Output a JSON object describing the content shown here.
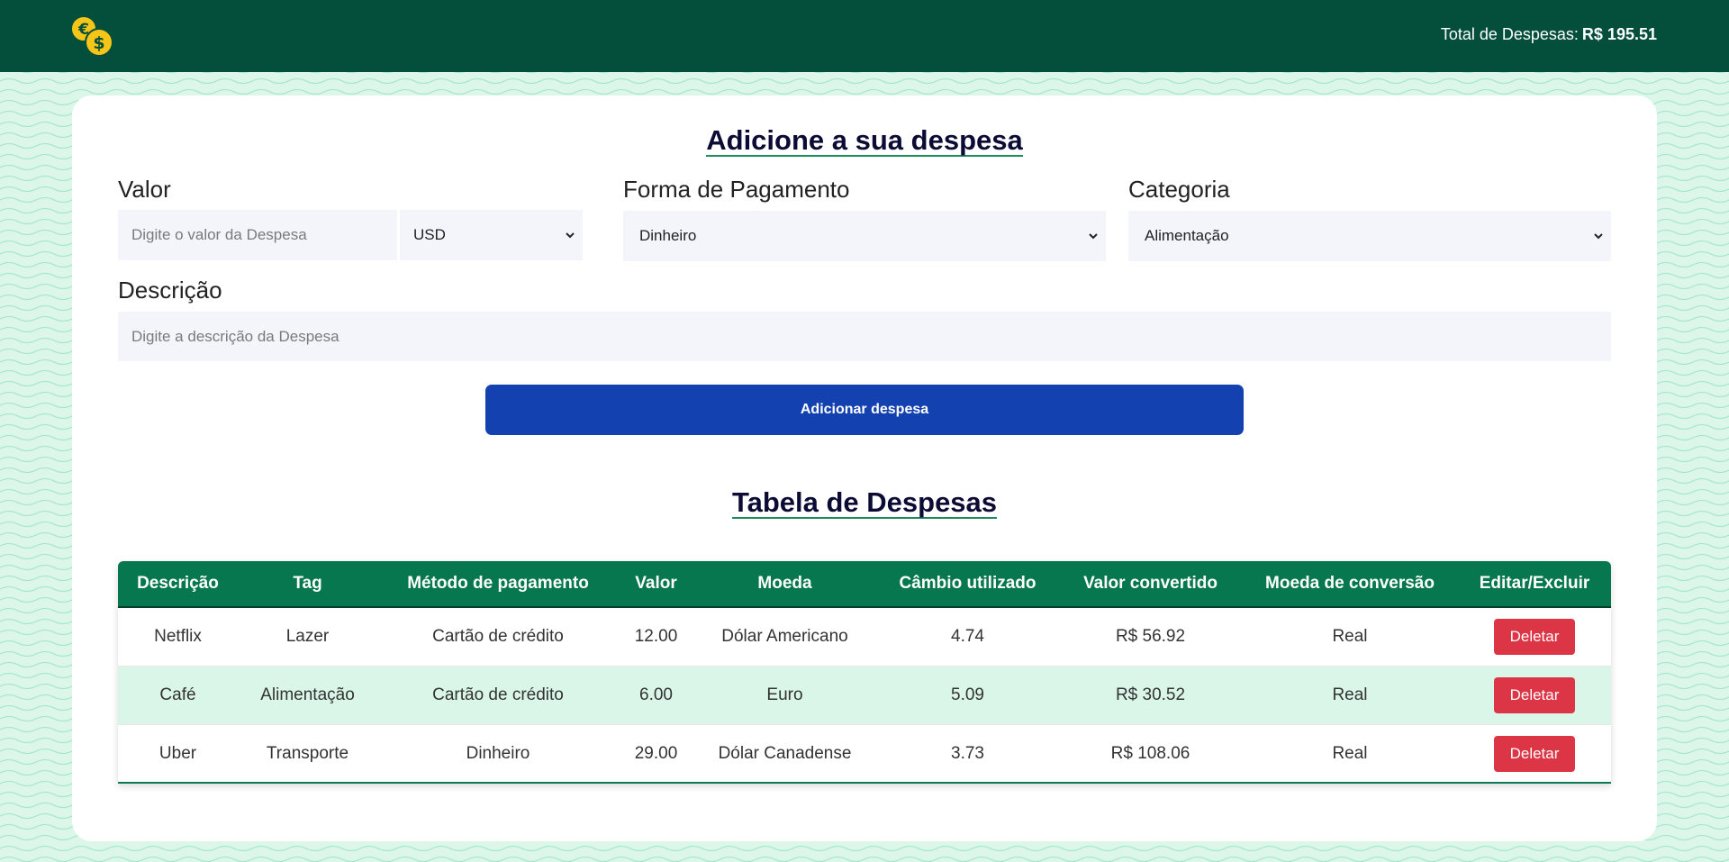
{
  "header": {
    "total_label": "Total de Despesas:",
    "total_value": "R$ 195.51",
    "logo_icon": "coins-euro-dollar-icon",
    "bg_color": "#044e3c",
    "coin_color": "#f5c518"
  },
  "form": {
    "title": "Adicione a sua despesa",
    "valor_label": "Valor",
    "valor_placeholder": "Digite o valor da Despesa",
    "currency_selected": "USD",
    "payment_label": "Forma de Pagamento",
    "payment_selected": "Dinheiro",
    "category_label": "Categoria",
    "category_selected": "Alimentação",
    "description_label": "Descrição",
    "description_placeholder": "Digite a descrição da Despesa",
    "submit_label": "Adicionar despesa"
  },
  "table": {
    "title": "Tabela de Despesas",
    "headers": [
      "Descrição",
      "Tag",
      "Método de pagamento",
      "Valor",
      "Moeda",
      "Câmbio utilizado",
      "Valor convertido",
      "Moeda de conversão",
      "Editar/Excluir"
    ],
    "rows": [
      {
        "descricao": "Netflix",
        "tag": "Lazer",
        "metodo": "Cartão de crédito",
        "valor": "12.00",
        "moeda": "Dólar Americano",
        "cambio": "4.74",
        "convertido": "R$ 56.92",
        "moeda_conversao": "Real",
        "action": "Deletar"
      },
      {
        "descricao": "Café",
        "tag": "Alimentação",
        "metodo": "Cartão de crédito",
        "valor": "6.00",
        "moeda": "Euro",
        "cambio": "5.09",
        "convertido": "R$ 30.52",
        "moeda_conversao": "Real",
        "action": "Deletar"
      },
      {
        "descricao": "Uber",
        "tag": "Transporte",
        "metodo": "Dinheiro",
        "valor": "29.00",
        "moeda": "Dólar Canadense",
        "cambio": "3.73",
        "convertido": "R$ 108.06",
        "moeda_conversao": "Real",
        "action": "Deletar"
      }
    ]
  },
  "colors": {
    "accent": "#1342b0",
    "header_green": "#06774f",
    "danger": "#dc3545",
    "row_alt": "#d9f6e8"
  }
}
